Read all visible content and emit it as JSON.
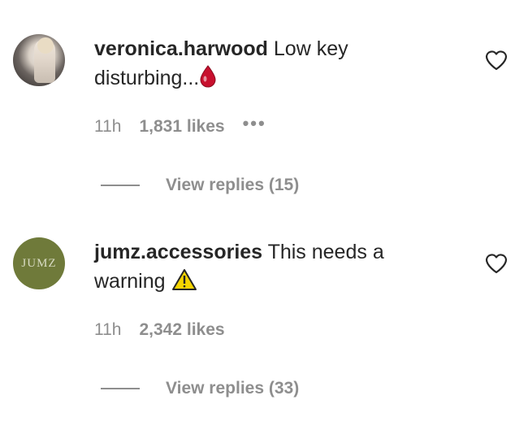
{
  "comments": [
    {
      "username": "veronica.harwood",
      "text": "Low key",
      "text_line2": "disturbing...",
      "emoji_icon": "blood-drop-icon",
      "time": "11h",
      "likes": "1,831 likes",
      "more_icon": "ellipsis-icon",
      "replies_label": "View replies (15)"
    },
    {
      "username": "jumz.accessories",
      "text": "This needs a",
      "text_line2": "warning",
      "emoji_icon": "warning-icon",
      "avatar_text": "JUMZ",
      "time": "11h",
      "likes": "2,342 likes",
      "replies_label": "View replies (33)"
    }
  ],
  "colors": {
    "text_primary": "#262626",
    "text_secondary": "#8e8e8e",
    "avatar_bg_2": "#6f7a3a",
    "blood_drop": "#c8102e",
    "warning_yellow": "#f5d400"
  }
}
